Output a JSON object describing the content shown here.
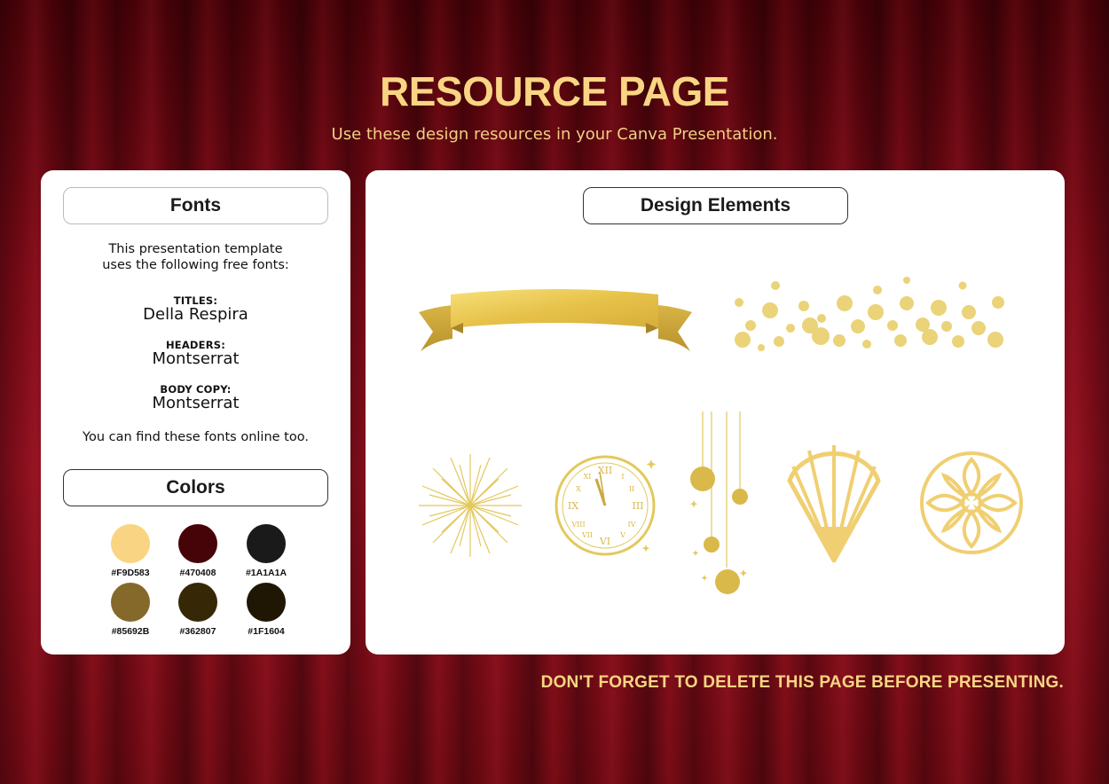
{
  "page": {
    "title": "RESOURCE PAGE",
    "subtitle": "Use these design resources in your Canva Presentation.",
    "footer_note": "DON'T FORGET TO DELETE THIS PAGE BEFORE PRESENTING."
  },
  "fonts_panel": {
    "heading": "Fonts",
    "intro_line1": "This presentation template",
    "intro_line2": "uses the following free fonts:",
    "titles_label": "TITLES:",
    "titles_font": "Della Respira",
    "headers_label": "HEADERS:",
    "headers_font": "Montserrat",
    "body_label": "BODY COPY:",
    "body_font": "Montserrat",
    "find_note": "You can find these fonts online too."
  },
  "colors_panel": {
    "heading": "Colors",
    "swatches": [
      {
        "hex": "#F9D583",
        "color": "#F9D583"
      },
      {
        "hex": "#470408",
        "color": "#470408"
      },
      {
        "hex": "#1A1A1A",
        "color": "#1A1A1A"
      },
      {
        "hex": "#85692B",
        "color": "#85692B"
      },
      {
        "hex": "#362807",
        "color": "#362807"
      },
      {
        "hex": "#1F1604",
        "color": "#1F1604"
      }
    ]
  },
  "design_panel": {
    "heading": "Design Elements",
    "elements": [
      "gold-ribbon-banner-icon",
      "gold-confetti-dots-icon",
      "starburst-icon",
      "clock-icon",
      "hanging-ornaments-icon",
      "art-deco-shell-icon",
      "art-deco-rosette-icon"
    ]
  },
  "theme": {
    "accent": "#F9D583",
    "background": "#7a0a16",
    "gold": "#E8C55A"
  }
}
